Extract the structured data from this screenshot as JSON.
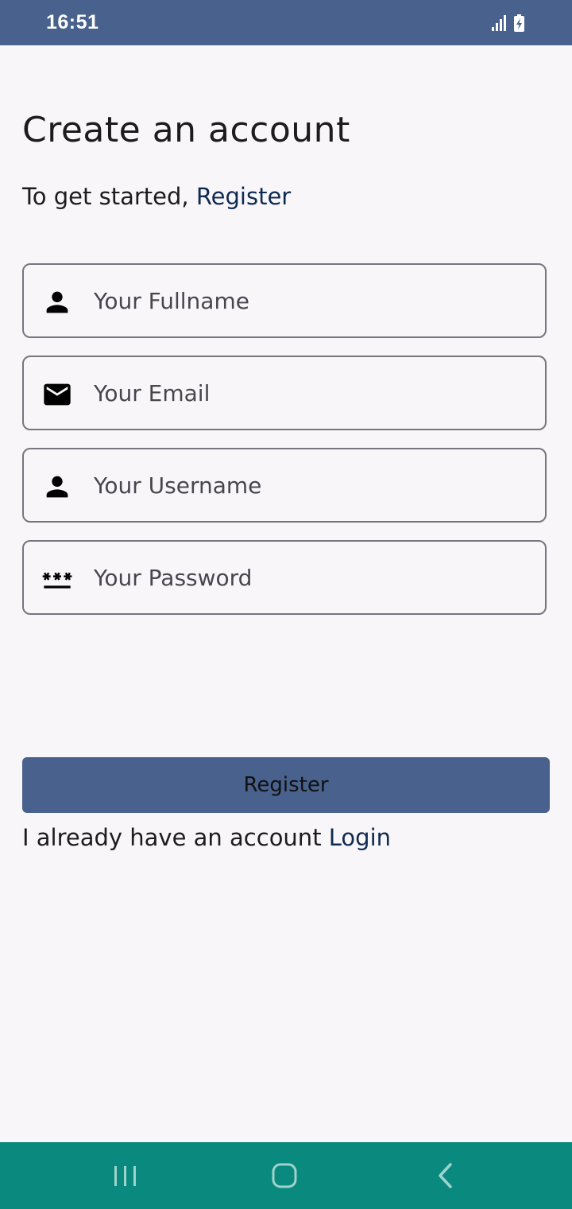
{
  "status_bar": {
    "time": "16:51",
    "icons": [
      "signal-icon",
      "battery-charging-icon"
    ],
    "background": "#48618d"
  },
  "header": {
    "title": "Create an account",
    "subtitle_prefix": "To get started, ",
    "subtitle_link": "Register"
  },
  "form": {
    "fields": [
      {
        "name": "fullname",
        "placeholder": "Your Fullname",
        "value": "",
        "icon": "person-icon"
      },
      {
        "name": "email",
        "placeholder": "Your Email",
        "value": "",
        "icon": "email-icon"
      },
      {
        "name": "username",
        "placeholder": "Your Username",
        "value": "",
        "icon": "person-icon"
      },
      {
        "name": "password",
        "placeholder": "Your Password",
        "value": "",
        "icon": "password-icon"
      }
    ],
    "submit_label": "Register"
  },
  "footer": {
    "login_prefix": "I already have an account ",
    "login_link": "Login"
  },
  "nav_bar": {
    "buttons": [
      "recent-apps-icon",
      "home-icon",
      "back-icon"
    ],
    "background": "#0a8a7e"
  },
  "colors": {
    "primary": "#48618d",
    "link": "#0f2a52",
    "background": "#f8f6f8",
    "outline": "#79747e"
  }
}
